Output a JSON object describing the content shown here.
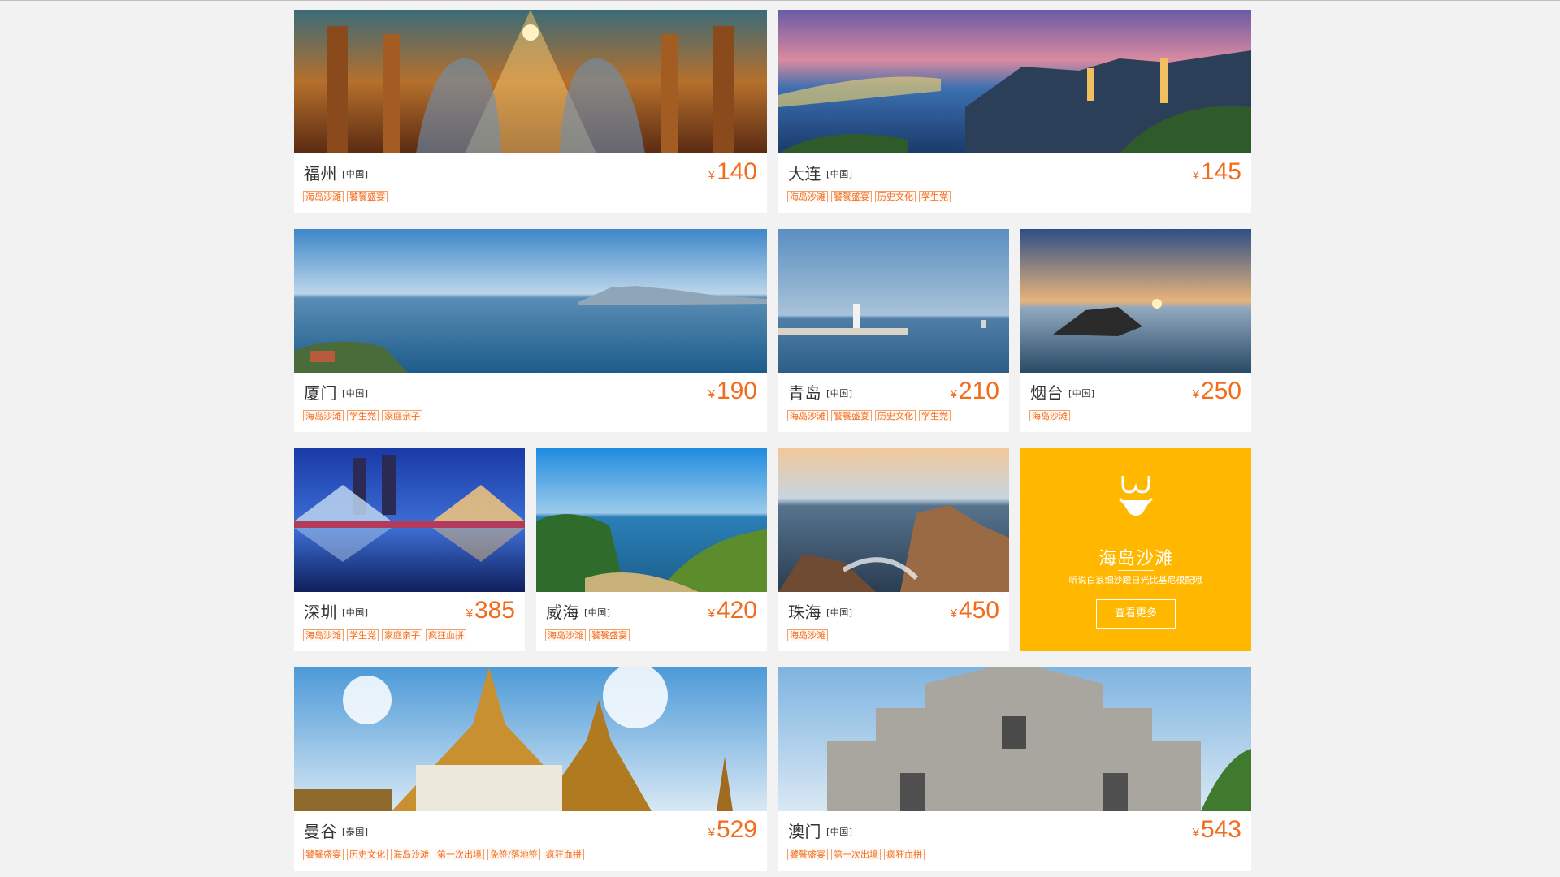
{
  "cards": [
    {
      "city": "福州",
      "country": "[中国]",
      "currency": "¥",
      "price": "140",
      "tags": [
        "海岛沙滩",
        "饕餮盛宴"
      ]
    },
    {
      "city": "大连",
      "country": "[中国]",
      "currency": "¥",
      "price": "145",
      "tags": [
        "海岛沙滩",
        "饕餮盛宴",
        "历史文化",
        "学生党"
      ]
    },
    {
      "city": "厦门",
      "country": "[中国]",
      "currency": "¥",
      "price": "190",
      "tags": [
        "海岛沙滩",
        "学生党",
        "家庭亲子"
      ]
    },
    {
      "city": "青岛",
      "country": "[中国]",
      "currency": "¥",
      "price": "210",
      "tags": [
        "海岛沙滩",
        "饕餮盛宴",
        "历史文化",
        "学生党"
      ]
    },
    {
      "city": "烟台",
      "country": "[中国]",
      "currency": "¥",
      "price": "250",
      "tags": [
        "海岛沙滩"
      ]
    },
    {
      "city": "深圳",
      "country": "[中国]",
      "currency": "¥",
      "price": "385",
      "tags": [
        "海岛沙滩",
        "学生党",
        "家庭亲子",
        "疯狂血拼"
      ]
    },
    {
      "city": "威海",
      "country": "[中国]",
      "currency": "¥",
      "price": "420",
      "tags": [
        "海岛沙滩",
        "饕餮盛宴"
      ]
    },
    {
      "city": "珠海",
      "country": "[中国]",
      "currency": "¥",
      "price": "450",
      "tags": [
        "海岛沙滩"
      ]
    },
    {
      "city": "曼谷",
      "country": "[泰国]",
      "currency": "¥",
      "price": "529",
      "tags": [
        "饕餮盛宴",
        "历史文化",
        "海岛沙滩",
        "第一次出境",
        "免签/落地签",
        "疯狂血拼"
      ]
    },
    {
      "city": "澳门",
      "country": "[中国]",
      "currency": "¥",
      "price": "543",
      "tags": [
        "饕餮盛宴",
        "第一次出境",
        "疯狂血拼"
      ]
    }
  ],
  "promo": {
    "icon": "bikini-icon",
    "title": "海岛沙滩",
    "subtitle": "听说白浪细沙跟日光比基尼很配哦",
    "button_label": "查看更多",
    "background_color": "#ffb700"
  },
  "colors": {
    "accent": "#f26c1d",
    "page_background": "#f2f2f2"
  }
}
